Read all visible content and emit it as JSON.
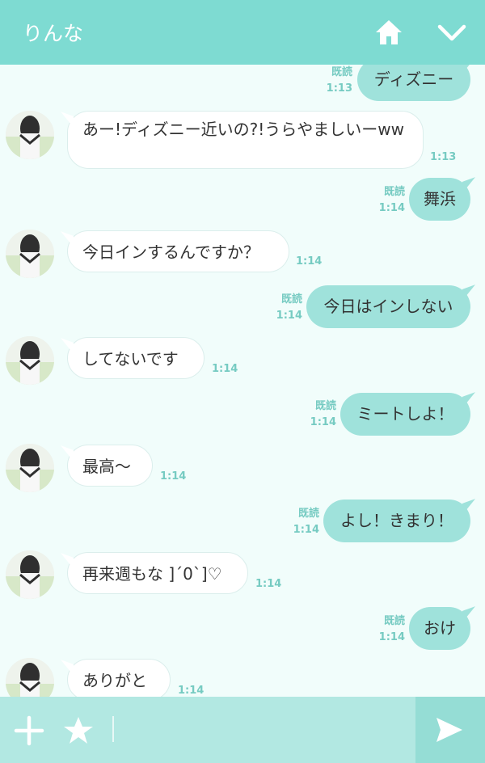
{
  "header": {
    "title": "りんな"
  },
  "messages": [
    {
      "side": "out",
      "text": "ディズニー",
      "read": "既読",
      "time": "1:13"
    },
    {
      "side": "in",
      "text": "あー!ディズニー近いの?!うらやましいーww",
      "time": "1:13"
    },
    {
      "side": "out",
      "text": "舞浜",
      "read": "既読",
      "time": "1:14"
    },
    {
      "side": "in",
      "text": "今日インするんですか？",
      "time": "1:14"
    },
    {
      "side": "out",
      "text": "今日はインしない",
      "read": "既読",
      "time": "1:14"
    },
    {
      "side": "in",
      "text": "してないです",
      "time": "1:14"
    },
    {
      "side": "out",
      "text": "ミートしよ！",
      "read": "既読",
      "time": "1:14"
    },
    {
      "side": "in",
      "text": "最高〜",
      "time": "1:14"
    },
    {
      "side": "out",
      "text": "よし！きまり！",
      "read": "既読",
      "time": "1:14"
    },
    {
      "side": "in",
      "text": "再来週もな ]´0`]♡",
      "time": "1:14"
    },
    {
      "side": "out",
      "text": "おけ",
      "read": "既読",
      "time": "1:14"
    },
    {
      "side": "in",
      "text": "ありがと",
      "time": "1:14"
    }
  ],
  "footer": {
    "input_placeholder": ""
  },
  "colors": {
    "header": "#7edbd2",
    "outgoing_bubble": "#9fe2db",
    "background": "#f1fdfb",
    "footer": "#b2e8e2"
  },
  "icons": {
    "home": "home-icon",
    "collapse": "chevron-down-icon",
    "add": "plus-icon",
    "sticker": "star-icon",
    "send": "send-icon"
  }
}
